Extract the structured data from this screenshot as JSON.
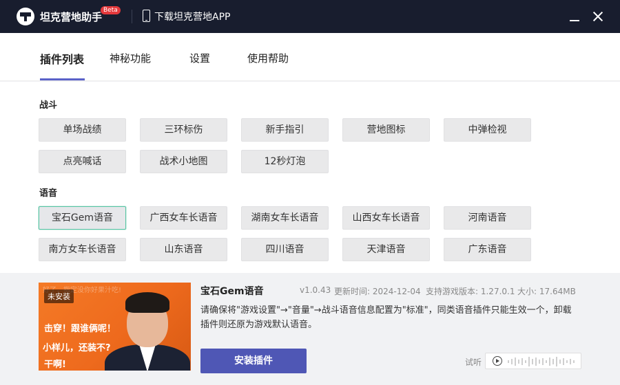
{
  "titlebar": {
    "app_name": "坦克营地助手",
    "badge": "Beta",
    "download_label": "下载坦克营地APP"
  },
  "tabs": [
    {
      "label": "插件列表",
      "active": true
    },
    {
      "label": "神秘功能",
      "active": false
    },
    {
      "label": "设置",
      "active": false
    },
    {
      "label": "使用帮助",
      "active": false
    }
  ],
  "sections": {
    "battle": {
      "title": "战斗",
      "items": [
        "单场战绩",
        "三环标伤",
        "新手指引",
        "营地图标",
        "中弹检视",
        "点亮喊话",
        "战术小地图",
        "12秒灯泡"
      ]
    },
    "voice": {
      "title": "语音",
      "items": [
        "宝石Gem语音",
        "广西女车长语音",
        "湖南女车长语音",
        "山西女车长语音",
        "河南语音",
        "南方女车长语音",
        "山东语音",
        "四川语音",
        "天津语音",
        "广东语音"
      ]
    }
  },
  "selected_plugin": {
    "name": "宝石Gem语音",
    "version": "v1.0.43",
    "update_time": "更新时间: 2024-12-04",
    "supported_version": "支持游戏版本: 1.27.0.1",
    "size": "大小: 17.64MB",
    "description": "请确保将\"游戏设置\"→\"音量\"→战斗语音信息配置为\"标准\"，同类语音插件只能生效一个，卸载插件则还原为游戏默认语音。",
    "status_badge": "未安装",
    "install_label": "安装插件",
    "preview_label": "试听",
    "thumbnail_text": [
      "击穿！跟谁俩呢！",
      "小样儿，还装不?",
      "干啊!",
      "好了，指定没你好果汁吃!"
    ]
  },
  "colors": {
    "titlebar_bg": "#181d2e",
    "accent": "#4f57b5",
    "selected_border": "#56c4a3",
    "beta_badge": "#e4393c"
  }
}
